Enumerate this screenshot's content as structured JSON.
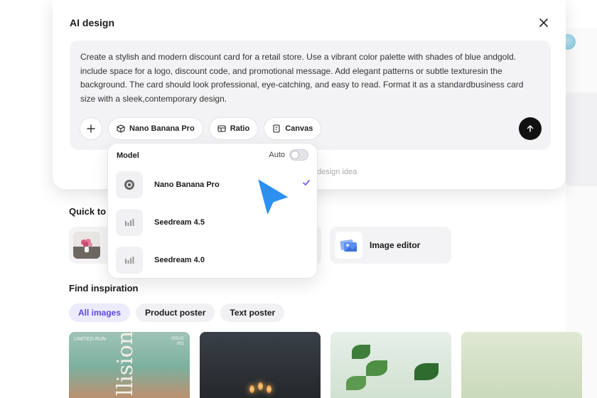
{
  "modal": {
    "title": "AI design",
    "prompt": "Create a stylish and modern discount card for a retail store. Use a vibrant color palette with shades of blue andgold. include space for a logo, discount code, and promotional message. Add elegant patterns or subtle texturesin the background. The card should look professional, eye-catching, and easy to read. Format it as a standardbusiness card size with a sleek,contemporary design.",
    "toolbar": {
      "model_label": "Nano Banana Pro",
      "ratio_label": "Ratio",
      "canvas_label": "Canvas"
    },
    "hint_partial": "design idea"
  },
  "model_dropdown": {
    "title": "Model",
    "auto_label": "Auto",
    "auto_enabled": false,
    "items": [
      {
        "label": "Nano Banana Pro",
        "selected": true
      },
      {
        "label": "Seedream 4.5",
        "selected": false
      },
      {
        "label": "Seedream 4.0",
        "selected": false
      }
    ]
  },
  "background": {
    "quick_title_partial": "Quick to",
    "quick_cards": [
      {
        "label": "Image editor"
      }
    ],
    "inspiration": {
      "title": "Find inspiration",
      "filters": [
        "All images",
        "Product poster",
        "Text poster"
      ],
      "active_filter": "All images",
      "gallery_texts": {
        "tag": "LIMITED-RUN",
        "issue": "ISSUE 001",
        "script": "llision"
      }
    }
  },
  "colors": {
    "accent": "#5b4bd6",
    "cursor": "#2d8ff0",
    "send_button": "#111111"
  }
}
